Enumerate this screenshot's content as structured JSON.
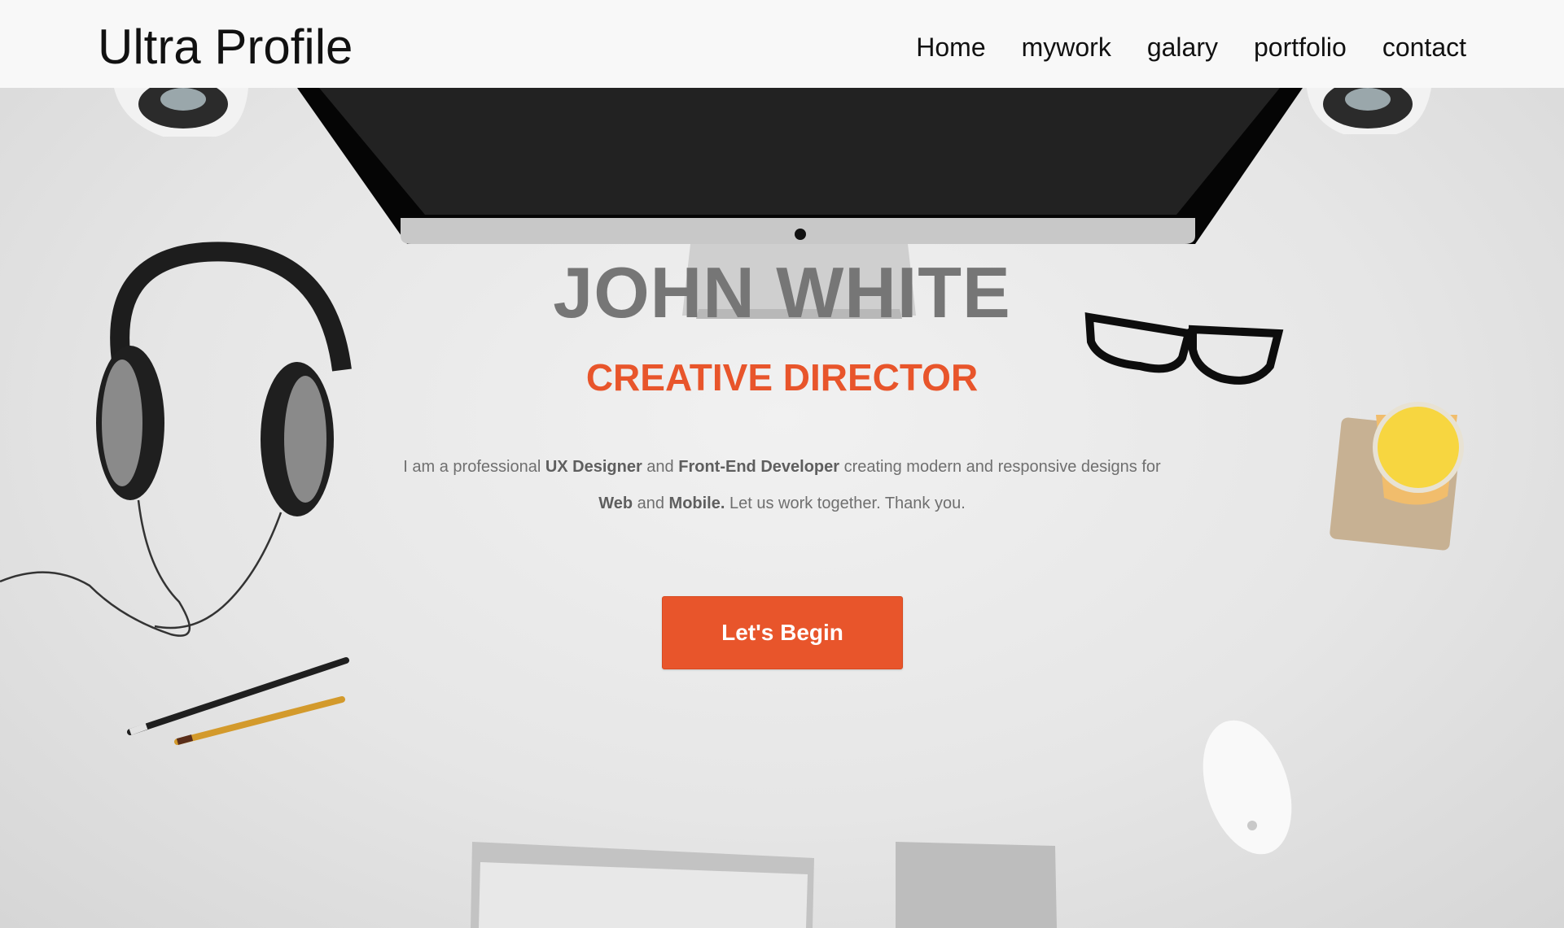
{
  "brand": {
    "title": "Ultra Profile"
  },
  "nav": {
    "items": [
      {
        "label": "Home"
      },
      {
        "label": "mywork"
      },
      {
        "label": "galary"
      },
      {
        "label": "portfolio"
      },
      {
        "label": "contact"
      }
    ]
  },
  "hero": {
    "name": "JOHN WHITE",
    "role": "CREATIVE DIRECTOR",
    "bio": {
      "t1": "I am a professional ",
      "b1": "UX Designer",
      "t2": " and ",
      "b2": "Front-End Developer",
      "t3": " creating modern and responsive designs for",
      "b3": "Web",
      "t4": " and ",
      "b4": "Mobile.",
      "t5": " Let us work together. Thank you."
    },
    "cta_label": "Let's Begin"
  },
  "colors": {
    "accent": "#e8552b",
    "name_gray": "#767676",
    "navbar_bg": "#f8f8f8"
  }
}
